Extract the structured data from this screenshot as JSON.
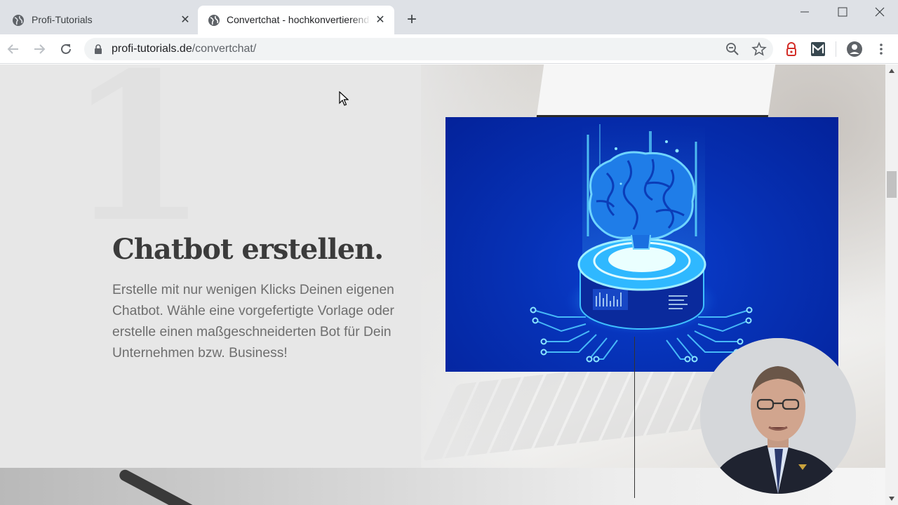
{
  "browser": {
    "tabs": [
      {
        "title": "Profi-Tutorials",
        "icon": "globe-icon",
        "active": false
      },
      {
        "title": "Convertchat - hochkonvertierende",
        "icon": "globe-icon",
        "active": true
      }
    ],
    "address": {
      "domain": "profi-tutorials.de",
      "path": "/convertchat/"
    },
    "extensions": [
      "lastpass-icon",
      "mailtrack-icon"
    ],
    "colors": {
      "tabstrip": "#dee1e6",
      "omnibox": "#f1f3f4",
      "extension_red": "#d32d27"
    }
  },
  "page": {
    "step_number": "1",
    "heading": "Chatbot erstellen.",
    "description": "Erstelle mit nur wenigen Klicks Deinen eigenen Chatbot. Wähle eine vorgefertigte Vorlage oder erstelle einen maßgeschneiderten Bot für Dein Unternehmen bzw. Business!",
    "image": "ai-brain-illustration",
    "colors": {
      "card_blue": "#0631b5",
      "glow": "#4fd6ff",
      "heading": "#3b3b3b",
      "text": "#6e6e6e"
    }
  },
  "overlay": {
    "webcam": "presenter-webcam"
  }
}
